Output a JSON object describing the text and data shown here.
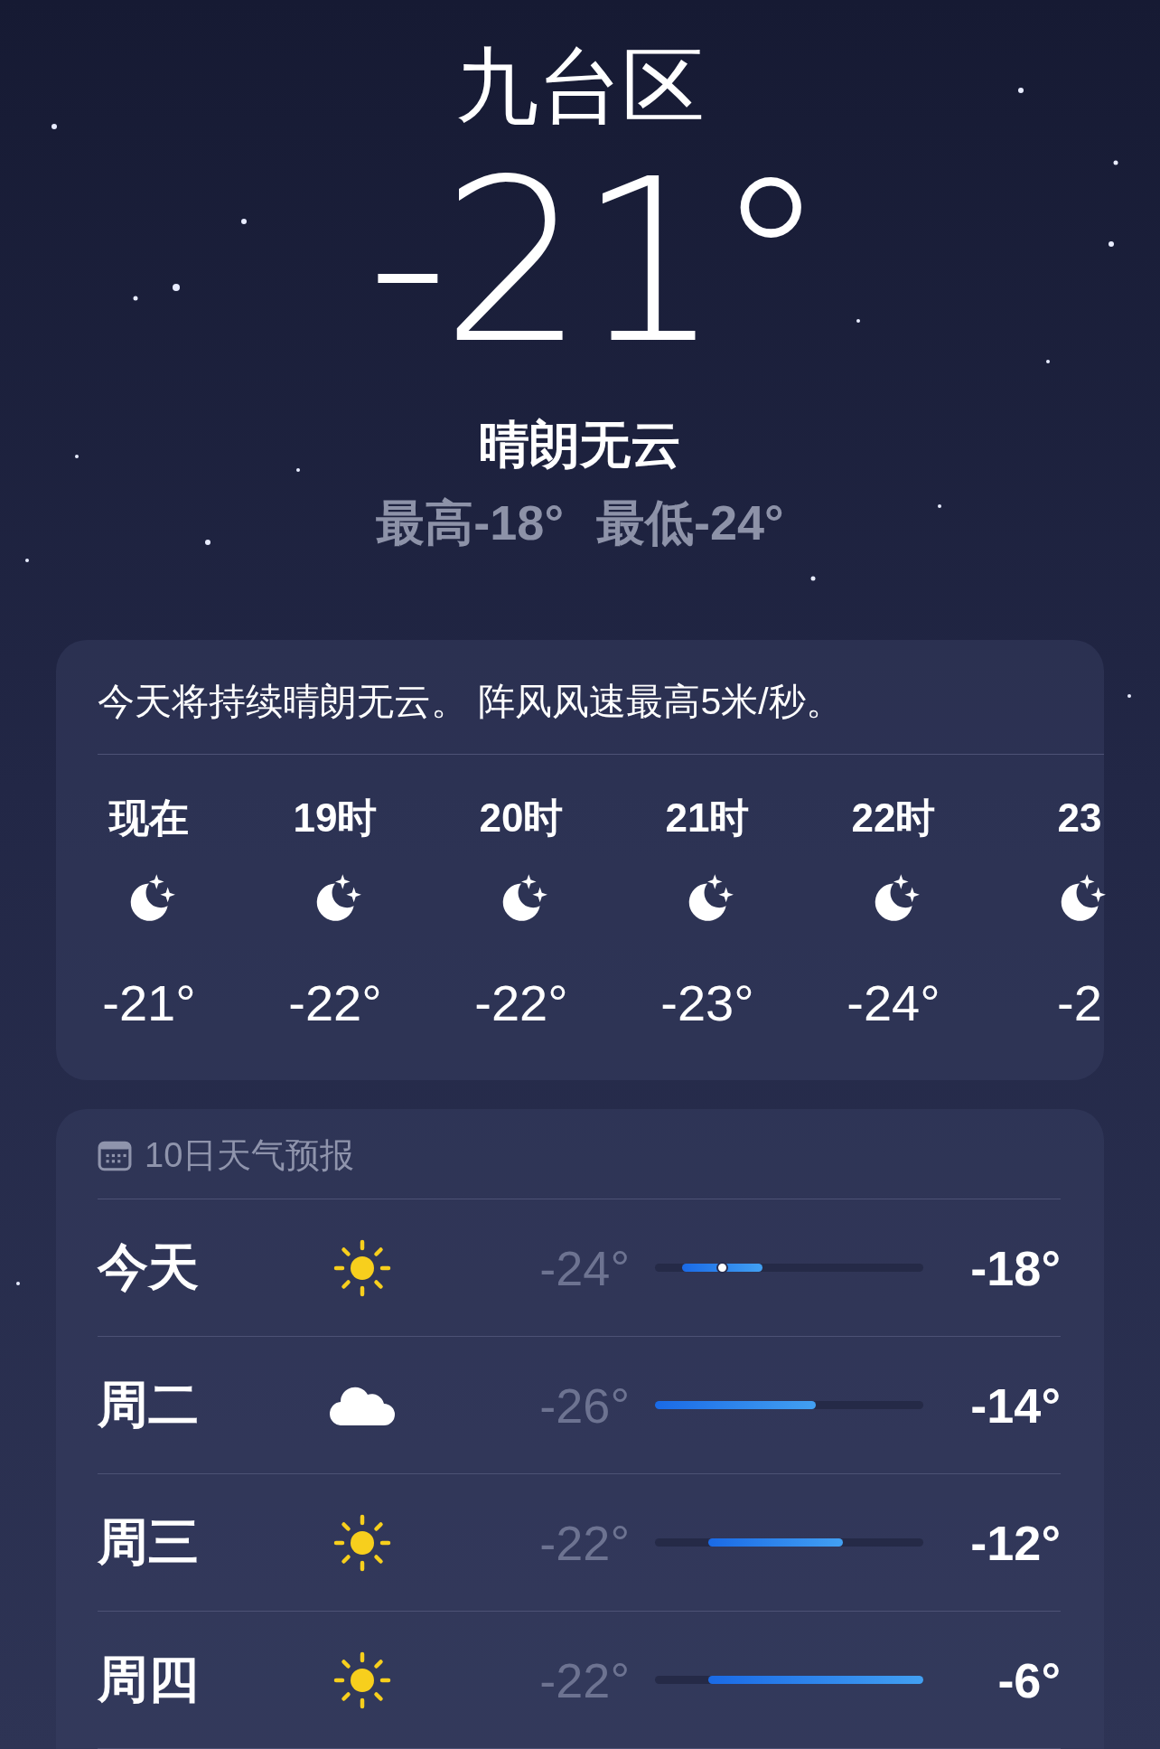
{
  "location": "九台区",
  "temperature": "-21°",
  "condition": "晴朗无云",
  "high": "最高-18°",
  "low": "最低-24°",
  "hourly": {
    "summary": "今天将持续晴朗无云。 阵风风速最高5米/秒。",
    "hours": [
      {
        "time": "现在",
        "kind": "moon",
        "temp": "-21°"
      },
      {
        "time": "19时",
        "kind": "moon",
        "temp": "-22°"
      },
      {
        "time": "20时",
        "kind": "moon",
        "temp": "-22°"
      },
      {
        "time": "21时",
        "kind": "moon",
        "temp": "-23°"
      },
      {
        "time": "22时",
        "kind": "moon",
        "temp": "-24°"
      },
      {
        "time": "23",
        "kind": "moon",
        "temp": "-2"
      }
    ]
  },
  "forecast": {
    "title": "10日天气预报",
    "days": [
      {
        "day": "今天",
        "kind": "sun",
        "low": "-24°",
        "high": "-18°",
        "current": true
      },
      {
        "day": "周二",
        "kind": "cloud",
        "low": "-26°",
        "high": "-14°",
        "current": false
      },
      {
        "day": "周三",
        "kind": "sun",
        "low": "-22°",
        "high": "-12°",
        "current": false
      },
      {
        "day": "周四",
        "kind": "sun",
        "low": "-22°",
        "high": "-6°",
        "current": false
      }
    ]
  }
}
